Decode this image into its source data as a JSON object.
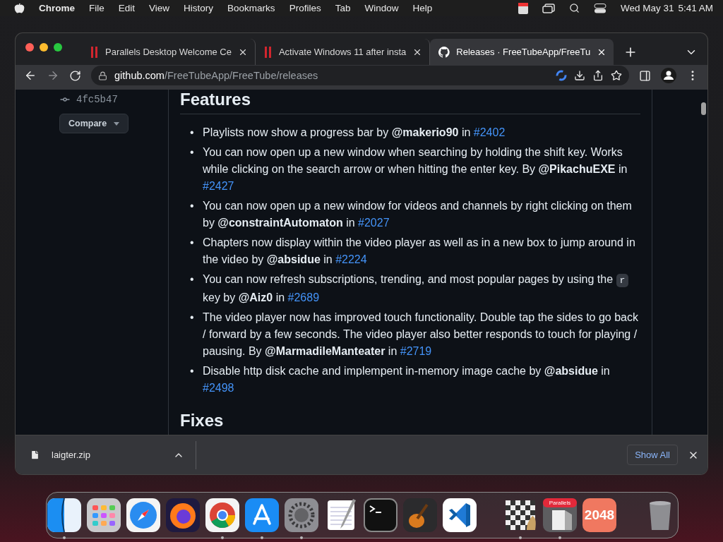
{
  "menu_bar": {
    "app": "Chrome",
    "items": [
      "File",
      "Edit",
      "View",
      "History",
      "Bookmarks",
      "Profiles",
      "Tab",
      "Window",
      "Help"
    ],
    "date": "Wed May 31",
    "time": "5:41 AM"
  },
  "tabs": [
    {
      "title": "Parallels Desktop Welcome Ce",
      "kind": "parallels",
      "selected": false
    },
    {
      "title": "Activate Windows 11 after insta",
      "kind": "parallels",
      "selected": false
    },
    {
      "title": "Releases · FreeTubeApp/FreeTu",
      "kind": "github",
      "selected": true
    }
  ],
  "address_bar": {
    "host": "github.com",
    "path": "/FreeTubeApp/FreeTube/releases"
  },
  "sidebar": {
    "commit": "4fc5b47",
    "compare_button": "Compare"
  },
  "sections": [
    {
      "heading": "Features",
      "items": [
        {
          "bullet": "•",
          "parts": [
            {
              "kind": "text",
              "text": "Playlists now show a progress bar by **@makerio90** in "
            },
            {
              "kind": "link",
              "text": "#2402"
            }
          ]
        },
        {
          "bullet": "•",
          "parts": [
            {
              "kind": "text",
              "text": "You can now open up a new window when searching by holding the shift key. Works while clicking on the search arrow or when hitting the enter key. By **@PikachuEXE** in "
            },
            {
              "kind": "link",
              "text": "#2427"
            }
          ]
        },
        {
          "bullet": "•",
          "parts": [
            {
              "kind": "text",
              "text": "You can now open up a new window for videos and channels by right clicking on them by **@constraintAutomaton** in "
            },
            {
              "kind": "link",
              "text": "#2027"
            }
          ]
        },
        {
          "bullet": "•",
          "parts": [
            {
              "kind": "text",
              "text": "Chapters now display within the video player as well as in a new box to jump around in the video by **@absidue** in "
            },
            {
              "kind": "link",
              "text": "#2224"
            }
          ]
        },
        {
          "bullet": "•",
          "parts": [
            {
              "kind": "text",
              "text": "You can now refresh subscriptions, trending, and most popular pages by using the "
            },
            {
              "kind": "code",
              "text": "r"
            },
            {
              "kind": "text",
              "text": " key by **@Aiz0** in "
            },
            {
              "kind": "link",
              "text": "#2689"
            }
          ]
        },
        {
          "bullet": "•",
          "parts": [
            {
              "kind": "text",
              "text": "The video player now has improved touch functionality. Double tap the sides to go back / forward by a few seconds. The video player also better responds to touch for playing / pausing. By **@MarmadileManteater** in "
            },
            {
              "kind": "link",
              "text": "#2719"
            }
          ]
        },
        {
          "bullet": "•",
          "parts": [
            {
              "kind": "text",
              "text": "Disable http disk cache and implempent in-memory image cache by **@absidue** in "
            },
            {
              "kind": "link",
              "text": "#2498"
            }
          ]
        }
      ]
    },
    {
      "heading": "Fixes"
    }
  ],
  "download_bar": {
    "file": "laigter.zip",
    "show_all": "Show All"
  },
  "dock": [
    {
      "kind": "finder",
      "running": true
    },
    {
      "kind": "launchpad",
      "running": false
    },
    {
      "kind": "safari",
      "running": false
    },
    {
      "kind": "firefox",
      "running": false
    },
    {
      "kind": "chrome",
      "running": true
    },
    {
      "kind": "appstore",
      "running": true
    },
    {
      "kind": "settings",
      "running": true
    },
    {
      "kind": "textedit",
      "running": false
    },
    {
      "kind": "terminal",
      "running": false
    },
    {
      "kind": "guitar",
      "running": false
    },
    {
      "kind": "vscode",
      "running": false
    },
    {
      "kind": "divider"
    },
    {
      "kind": "chess",
      "running": true
    },
    {
      "kind": "parallels",
      "label": "Parallels",
      "running": true
    },
    {
      "kind": "game",
      "label": "2048",
      "running": false
    },
    {
      "kind": "divider"
    },
    {
      "kind": "trash",
      "running": false
    }
  ]
}
